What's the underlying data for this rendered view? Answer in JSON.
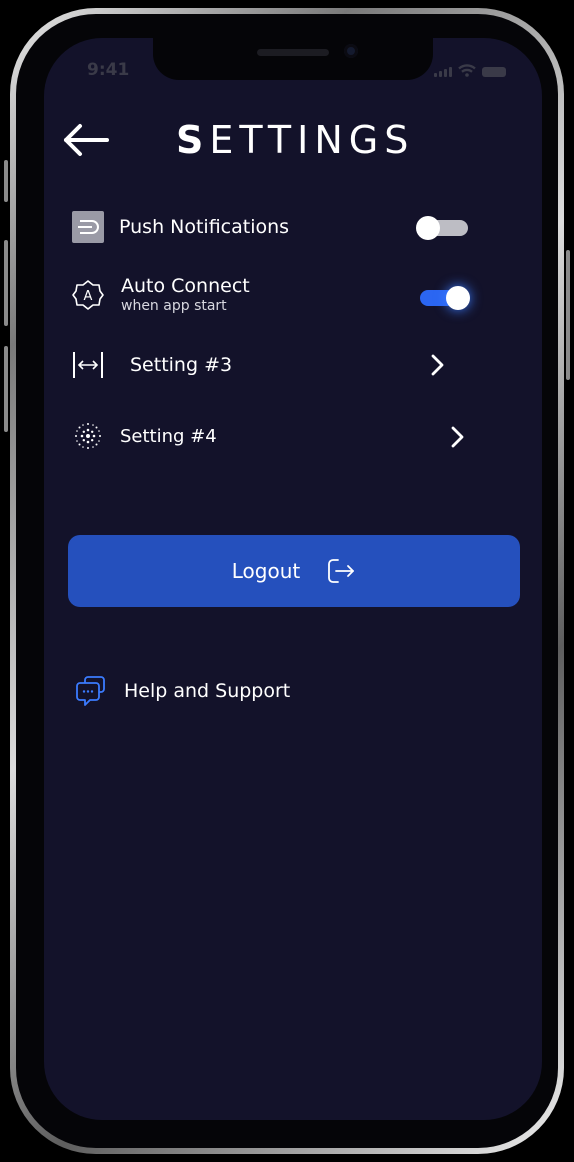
{
  "status_bar": {
    "time": "9:41"
  },
  "header": {
    "title_first": "S",
    "title_rest": "ETTINGS"
  },
  "settings": [
    {
      "label": "Push Notifications",
      "icon": "notification-icon",
      "toggle": false
    },
    {
      "label": "Auto Connect",
      "sublabel": "when app start",
      "icon": "auto-connect-icon",
      "toggle": true
    },
    {
      "label": "Setting #3",
      "icon": "expand-width-icon"
    },
    {
      "label": "Setting #4",
      "icon": "dots-burst-icon"
    }
  ],
  "logout": {
    "label": "Logout"
  },
  "help": {
    "label": "Help and Support"
  },
  "colors": {
    "background": "#13122a",
    "accent": "#2550bd",
    "toggle_on": "#2b66f2",
    "toggle_off": "#bdbdc4"
  }
}
